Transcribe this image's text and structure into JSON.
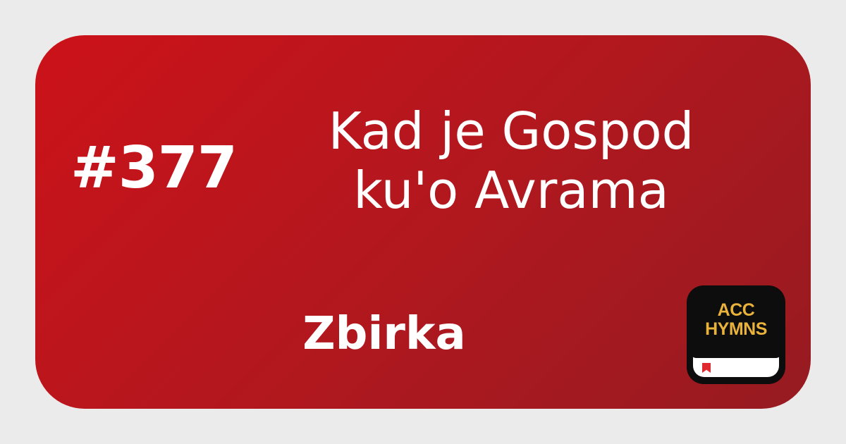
{
  "hymn": {
    "number": "#377",
    "title_line_1": "Kad je Gospod",
    "title_line_2": "ku\u001d'o Avrama",
    "collection": "Zbirka"
  },
  "logo": {
    "line_1": "ACC",
    "line_2": "HYMNS",
    "text_color": "#e9b23b",
    "background_color": "#0d0d0d",
    "bookmark_color": "#e0282f"
  },
  "colors": {
    "card_gradient_start": "#cc1219",
    "card_gradient_end": "#961b21",
    "frame": "#ebebeb",
    "text": "#ffffff"
  }
}
